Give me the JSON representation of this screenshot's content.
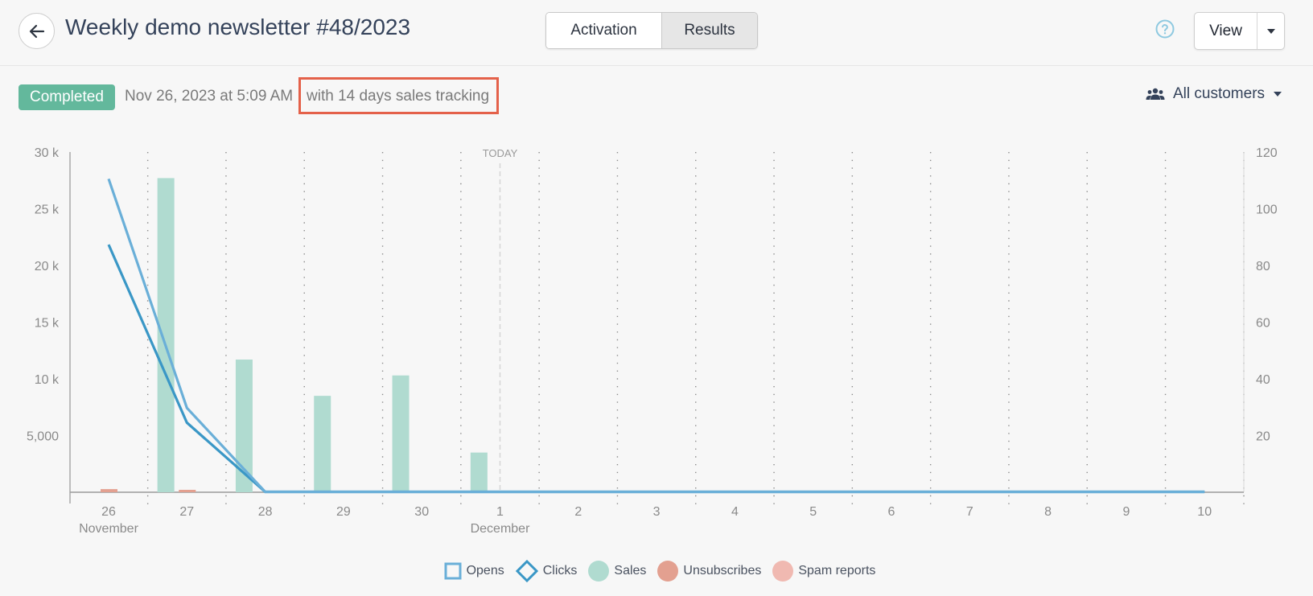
{
  "header": {
    "title": "Weekly demo newsletter #48/2023",
    "tabs": [
      {
        "label": "Activation",
        "active": false
      },
      {
        "label": "Results",
        "active": true
      }
    ],
    "view_label": "View"
  },
  "status": {
    "badge": "Completed",
    "badge_color": "#63b89c",
    "sent_date": "Nov 26, 2023 at 5:09 AM",
    "separator": "·",
    "tracking": "with 14 days sales tracking",
    "highlight_color": "#e4614a"
  },
  "segment": {
    "label": "All customers"
  },
  "colors": {
    "opens": "#6aafd8",
    "clicks": "#3a97c6",
    "sales": "#b0dbd0",
    "unsubscribes": "#e3a090",
    "spam": "#f0b9b1"
  },
  "chart_data": {
    "type": "bar+line",
    "today_label": "TODAY",
    "today_index": 5,
    "categories": [
      "26",
      "27",
      "28",
      "29",
      "30",
      "1",
      "2",
      "3",
      "4",
      "5",
      "6",
      "7",
      "8",
      "9",
      "10"
    ],
    "month_labels": [
      {
        "index": 0,
        "label": "November"
      },
      {
        "index": 5,
        "label": "December"
      }
    ],
    "y_left": {
      "ticks": [
        "5,000",
        "10 k",
        "15 k",
        "20 k",
        "25 k",
        "30 k"
      ],
      "tick_values": [
        5000,
        10000,
        15000,
        20000,
        25000,
        30000
      ],
      "range": [
        0,
        30000
      ]
    },
    "y_right": {
      "ticks": [
        "20",
        "40",
        "60",
        "80",
        "100",
        "120"
      ],
      "tick_values": [
        20,
        40,
        60,
        80,
        100,
        120
      ],
      "range": [
        0,
        120
      ]
    },
    "series": [
      {
        "name": "Opens",
        "kind": "line",
        "axis": "left",
        "values": [
          27600,
          7400,
          0,
          0,
          0,
          0,
          0,
          0,
          0,
          0,
          0,
          0,
          0,
          0,
          0
        ]
      },
      {
        "name": "Clicks",
        "kind": "line",
        "axis": "left",
        "values": [
          21800,
          6100,
          0,
          0,
          0,
          0,
          0,
          0,
          0,
          0,
          0,
          0,
          0,
          0,
          0
        ]
      },
      {
        "name": "Sales",
        "kind": "bar",
        "axis": "left",
        "values": [
          0,
          27700,
          11700,
          8500,
          10300,
          3500,
          0,
          0,
          0,
          0,
          0,
          0,
          0,
          0,
          0
        ]
      },
      {
        "name": "Unsubscribes",
        "kind": "bar",
        "axis": "right",
        "values": [
          2,
          1,
          0,
          0,
          0,
          0,
          0,
          0,
          0,
          0,
          0,
          0,
          0,
          0,
          0
        ]
      },
      {
        "name": "Spam reports",
        "kind": "bar",
        "axis": "right",
        "values": [
          0,
          0,
          0,
          0,
          0,
          0,
          0,
          0,
          0,
          0,
          0,
          0,
          0,
          0,
          0
        ]
      }
    ],
    "legend": [
      {
        "name": "Opens",
        "marker": "square"
      },
      {
        "name": "Clicks",
        "marker": "diamond"
      },
      {
        "name": "Sales",
        "marker": "circle"
      },
      {
        "name": "Unsubscribes",
        "marker": "circle"
      },
      {
        "name": "Spam reports",
        "marker": "circle"
      }
    ],
    "legend_position": "bottom",
    "grid": "vertical-dotted"
  }
}
